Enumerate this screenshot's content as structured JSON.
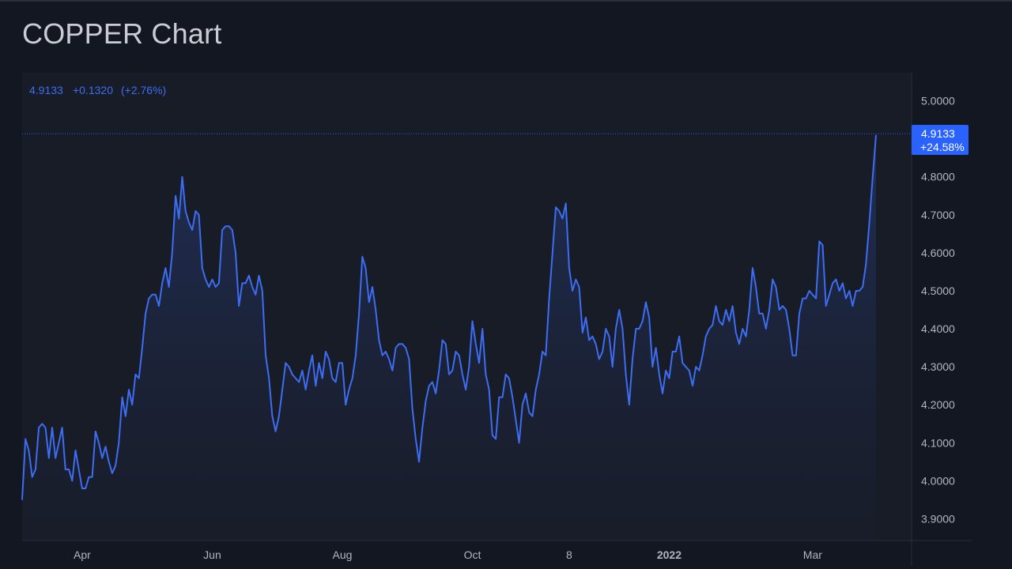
{
  "page": {
    "title": "COPPER Chart"
  },
  "legend": {
    "last": "4.9133",
    "change": "+0.1320",
    "change_pct": "(+2.76%)"
  },
  "price_tag": {
    "value": "4.9133",
    "change_pct": "+24.58%"
  },
  "colors": {
    "background": "#131722",
    "plot_background": "#181c27",
    "line": "#3d6df2",
    "accent": "#2962ff",
    "text": "#b2b5be"
  },
  "chart_data": {
    "type": "area",
    "title": "COPPER Chart",
    "xlabel": "",
    "ylabel": "",
    "ylim": [
      3.85,
      5.07
    ],
    "yticks": [
      "5.0000",
      "4.9000",
      "4.8000",
      "4.7000",
      "4.6000",
      "4.5000",
      "4.4000",
      "4.3000",
      "4.2000",
      "4.1000",
      "4.0000",
      "3.9000"
    ],
    "ytick_values": [
      5.0,
      4.9,
      4.8,
      4.7,
      4.6,
      4.5,
      4.4,
      4.3,
      4.2,
      4.1,
      4.0,
      3.9
    ],
    "xticks": [
      "Apr",
      "Jun",
      "Aug",
      "Oct",
      "8",
      "2022",
      "Mar"
    ],
    "xtick_positions": [
      18,
      57,
      96,
      135,
      164,
      194,
      237
    ],
    "grid": false,
    "last_value": 4.9133,
    "series": [
      {
        "values": [
          3.95,
          4.11,
          4.08,
          4.01,
          4.03,
          4.14,
          4.15,
          4.14,
          4.06,
          4.14,
          4.06,
          4.1,
          4.14,
          4.03,
          4.03,
          4.0,
          4.08,
          4.03,
          3.98,
          3.98,
          4.01,
          4.01,
          4.13,
          4.1,
          4.06,
          4.09,
          4.05,
          4.02,
          4.04,
          4.1,
          4.22,
          4.17,
          4.24,
          4.2,
          4.28,
          4.27,
          4.35,
          4.44,
          4.48,
          4.49,
          4.49,
          4.46,
          4.52,
          4.56,
          4.51,
          4.6,
          4.75,
          4.69,
          4.8,
          4.71,
          4.68,
          4.66,
          4.71,
          4.7,
          4.56,
          4.53,
          4.51,
          4.53,
          4.51,
          4.52,
          4.66,
          4.67,
          4.67,
          4.66,
          4.6,
          4.46,
          4.52,
          4.52,
          4.54,
          4.51,
          4.49,
          4.54,
          4.5,
          4.33,
          4.27,
          4.17,
          4.13,
          4.17,
          4.24,
          4.31,
          4.3,
          4.28,
          4.27,
          4.26,
          4.29,
          4.24,
          4.29,
          4.33,
          4.25,
          4.31,
          4.27,
          4.34,
          4.32,
          4.27,
          4.26,
          4.31,
          4.31,
          4.2,
          4.24,
          4.27,
          4.33,
          4.44,
          4.59,
          4.56,
          4.47,
          4.51,
          4.45,
          4.37,
          4.33,
          4.34,
          4.32,
          4.29,
          4.35,
          4.36,
          4.36,
          4.35,
          4.32,
          4.19,
          4.11,
          4.05,
          4.14,
          4.21,
          4.25,
          4.26,
          4.23,
          4.29,
          4.37,
          4.36,
          4.28,
          4.29,
          4.34,
          4.33,
          4.28,
          4.24,
          4.3,
          4.42,
          4.36,
          4.31,
          4.4,
          4.28,
          4.24,
          4.12,
          4.11,
          4.22,
          4.22,
          4.28,
          4.27,
          4.22,
          4.16,
          4.1,
          4.2,
          4.23,
          4.18,
          4.17,
          4.24,
          4.28,
          4.34,
          4.33,
          4.48,
          4.6,
          4.72,
          4.71,
          4.69,
          4.73,
          4.56,
          4.5,
          4.53,
          4.51,
          4.39,
          4.43,
          4.37,
          4.38,
          4.36,
          4.32,
          4.34,
          4.4,
          4.38,
          4.3,
          4.4,
          4.45,
          4.4,
          4.28,
          4.2,
          4.32,
          4.4,
          4.4,
          4.42,
          4.47,
          4.43,
          4.3,
          4.35,
          4.28,
          4.23,
          4.29,
          4.27,
          4.34,
          4.34,
          4.38,
          4.31,
          4.3,
          4.29,
          4.25,
          4.3,
          4.29,
          4.33,
          4.38,
          4.4,
          4.41,
          4.46,
          4.42,
          4.41,
          4.45,
          4.42,
          4.46,
          4.39,
          4.36,
          4.4,
          4.38,
          4.45,
          4.56,
          4.51,
          4.44,
          4.44,
          4.4,
          4.45,
          4.53,
          4.51,
          4.45,
          4.46,
          4.45,
          4.4,
          4.33,
          4.33,
          4.44,
          4.48,
          4.48,
          4.5,
          4.49,
          4.48,
          4.63,
          4.62,
          4.46,
          4.49,
          4.52,
          4.53,
          4.5,
          4.52,
          4.48,
          4.5,
          4.46,
          4.5,
          4.5,
          4.51,
          4.57,
          4.68,
          4.8,
          4.91
        ]
      }
    ]
  }
}
